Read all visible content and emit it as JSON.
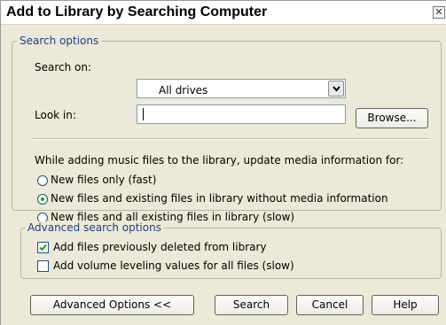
{
  "window": {
    "title": "Add to Library by Searching Computer",
    "close_glyph": "✕"
  },
  "search_options": {
    "legend": "Search options",
    "search_on_label": "Search on:",
    "search_on_value": "All drives",
    "look_in_label": "Look in:",
    "look_in_value": "",
    "browse_label": "Browse...",
    "update_prompt": "While adding music files to the library, update media information for:",
    "options": [
      {
        "label": "New files only (fast)",
        "selected": false
      },
      {
        "label": "New files and existing files in library without media information",
        "selected": true
      },
      {
        "label": "New files and all existing files in library (slow)",
        "selected": false
      }
    ]
  },
  "advanced_search": {
    "legend": "Advanced search options",
    "options": [
      {
        "label": "Add files previously deleted from library",
        "checked": true
      },
      {
        "label": "Add volume leveling values for all files (slow)",
        "checked": false
      }
    ]
  },
  "buttons": {
    "advanced_label": "Advanced Options <<",
    "search_label": "Search",
    "cancel_label": "Cancel",
    "help_label": "Help"
  }
}
